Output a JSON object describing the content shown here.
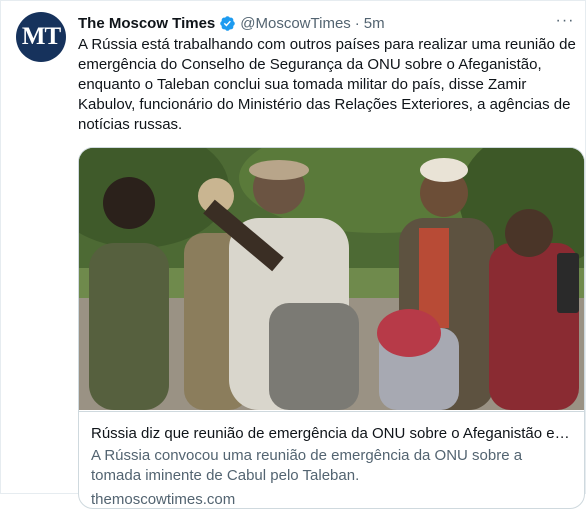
{
  "tweet": {
    "avatar_text": "MT",
    "author_name": "The Moscow Times",
    "handle": "@MoscowTimes",
    "separator": "·",
    "time": "5m",
    "more_label": "···",
    "text": "A Rússia está trabalhando com outros países para realizar uma reunião de emergência do Conselho de Segurança da ONU sobre o Afeganistão, enquanto o Taleban conclui sua tomada militar do país, disse Zamir Kabulov, funcionário do Ministério das Relações Exteriores, a agências de notícias russas."
  },
  "card": {
    "title": "Rússia diz que reunião de emergência da ONU sobre o Afeganistão está sendo preparada",
    "description": "A Rússia convocou uma reunião de emergência da ONU sobre a tomada iminente de Cabul pelo Taleban.",
    "domain": "themoscowtimes.com"
  },
  "colors": {
    "verified": "#1d9bf0",
    "avatar_bg": "#16325c",
    "secondary_text": "#536471"
  },
  "icons": [
    "verified-badge-icon",
    "more-options-icon"
  ]
}
